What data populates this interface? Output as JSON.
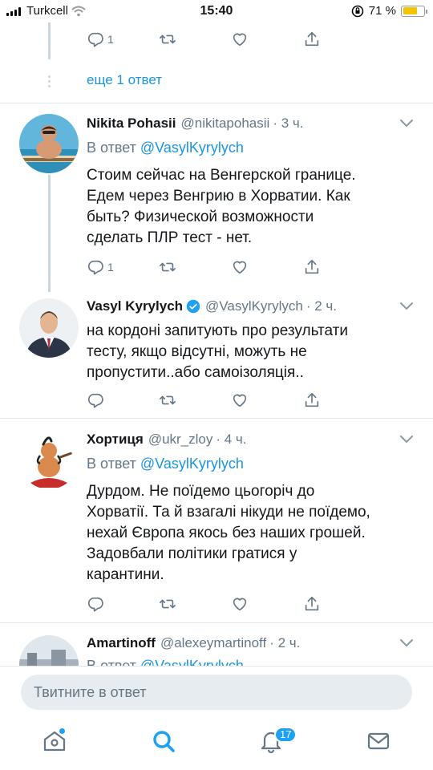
{
  "status_bar": {
    "carrier": "Turkcell",
    "time": "15:40",
    "battery_percent": "71 %",
    "battery_level": 0.71,
    "battery_color": "#f5c400"
  },
  "thread_top": {
    "reply_count": "1",
    "more_replies_label": "еще 1 ответ"
  },
  "tweets": [
    {
      "name": "Nikita Pohasii",
      "handle": "@nikitapohasii",
      "time": "· 3 ч.",
      "reply_to_prefix": "В ответ",
      "reply_to_mention": "@VasylKyrylych",
      "text_lines": [
        "Стоим сейчас на Венгерской границе.",
        "Едем через Венгрию в Хорватии. Как",
        "быть? Физической возможности",
        "сделать ПЛР тест - нет."
      ],
      "reply_count": "1"
    },
    {
      "name": "Vasyl Kyrylych",
      "handle": "@VasylKyrylych",
      "time": "· 2 ч.",
      "verified": true,
      "text_lines": [
        "на кордоні запитують про результати",
        "тесту, якщо відсутні, можуть не",
        "пропустити..або самоізоляція.."
      ],
      "reply_count": ""
    },
    {
      "name": "Хортиця",
      "handle": "@ukr_zloy",
      "time": "· 4 ч.",
      "reply_to_prefix": "В ответ",
      "reply_to_mention": "@VasylKyrylych",
      "text_lines": [
        "Дурдом. Не поїдемо цьогоріч до",
        "Хорватії. Та й взагалі нікуди не поїдемо,",
        "нехай Європа якось без наших грошей.",
        "Задовбали політики гратися у",
        "карантини."
      ],
      "reply_count": ""
    },
    {
      "name": "Amartinoff",
      "handle": "@alexeymartinoff",
      "time": "· 2 ч.",
      "reply_to_prefix": "В ответ",
      "reply_to_mention": "@VasylKyrylych"
    }
  ],
  "compose": {
    "placeholder": "Твитните в ответ"
  },
  "tab_bar": {
    "notifications_badge": "17",
    "accent_color": "#1da1f2"
  },
  "icons": [
    "reply-icon",
    "retweet-icon",
    "like-icon",
    "share-icon",
    "chevron-down-icon",
    "verified-icon",
    "home-icon",
    "search-icon",
    "bell-icon",
    "mail-icon"
  ]
}
